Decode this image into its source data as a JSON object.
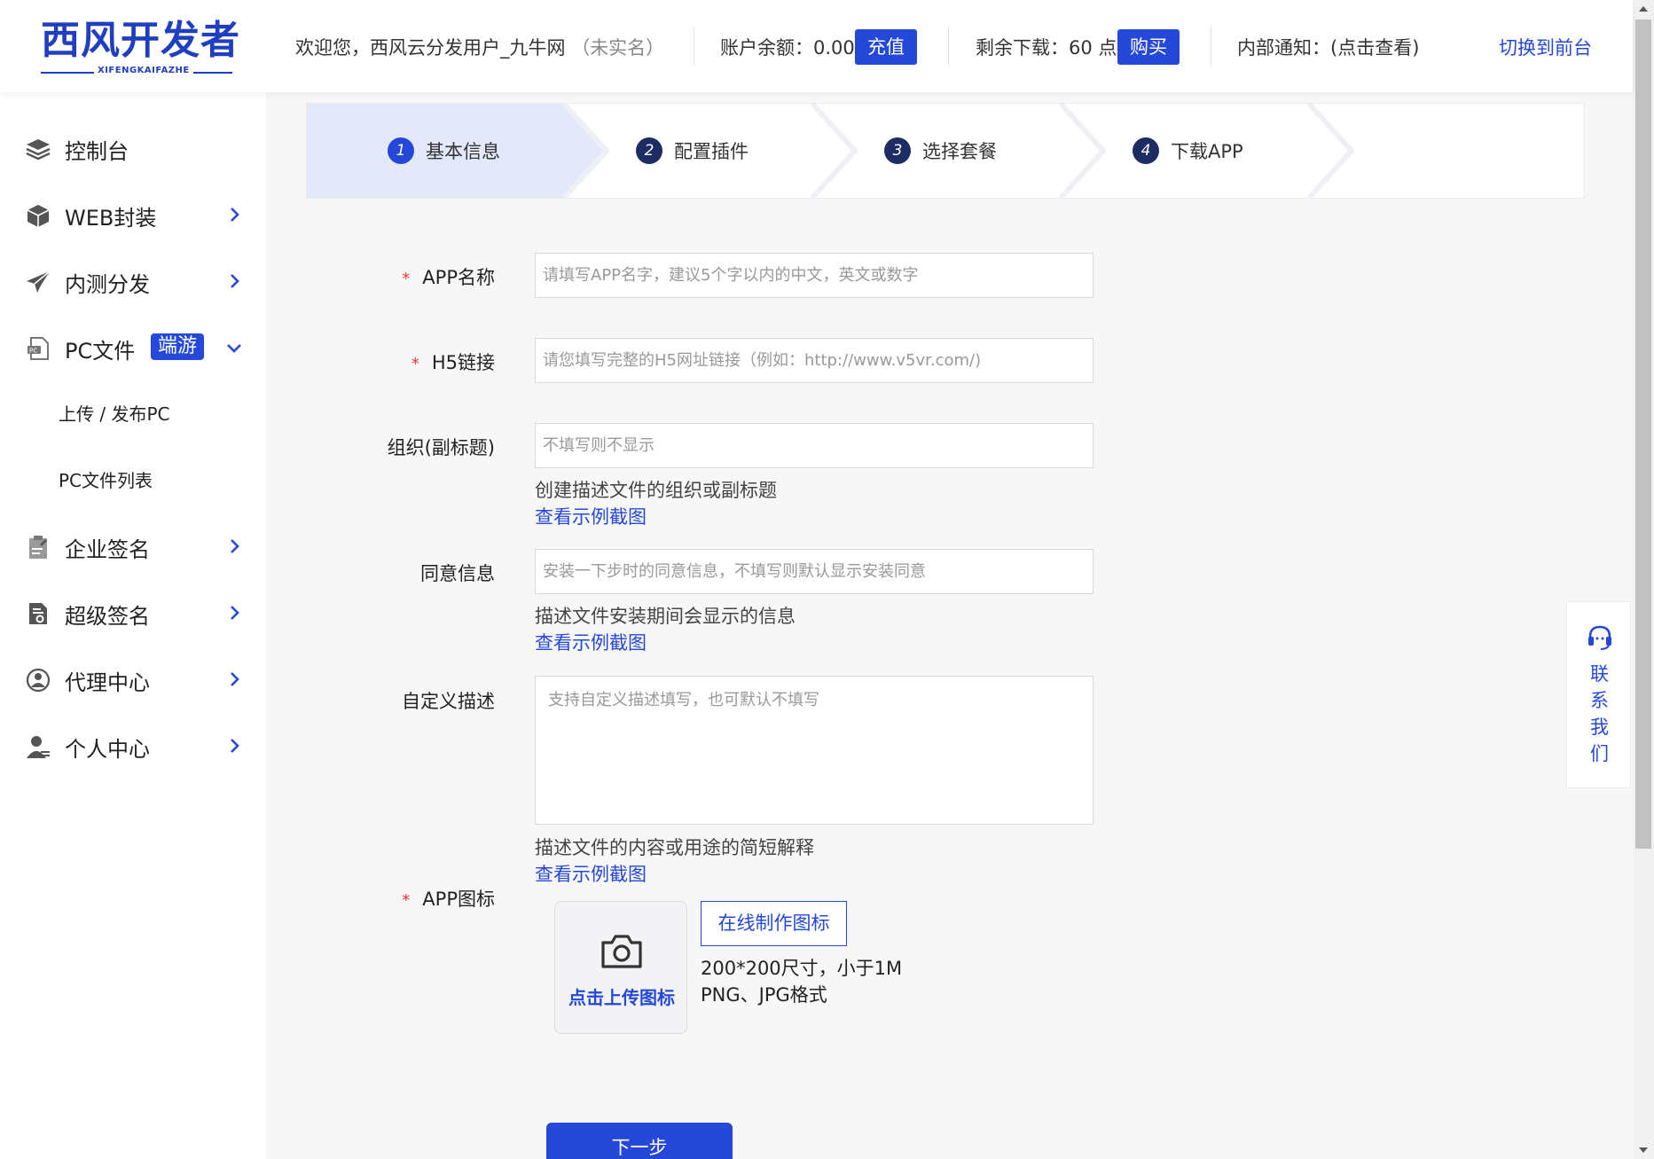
{
  "header": {
    "logo_main": "西风开发者",
    "logo_sub": "XIFENGKAIFAZHE",
    "welcome_prefix": "欢迎您，西风云分发用户_九牛网",
    "welcome_status": "（未实名）",
    "balance_label": "账户余额：0.00",
    "recharge_button": "充值",
    "downloads_label": "剩余下载：60 点",
    "buy_button": "购买",
    "notice_label": "内部通知：(点击查看)",
    "switch_link": "切换到前台"
  },
  "sidebar": {
    "items": [
      {
        "label": "控制台",
        "icon": "layers-icon"
      },
      {
        "label": "WEB封装",
        "icon": "package-icon"
      },
      {
        "label": "内测分发",
        "icon": "paper-plane-icon"
      },
      {
        "label": "PC文件",
        "icon": "pc-file-icon",
        "badge": "端游"
      },
      {
        "label": "企业签名",
        "icon": "clipboard-icon"
      },
      {
        "label": "超级签名",
        "icon": "certificate-icon"
      },
      {
        "label": "代理中心",
        "icon": "agent-icon"
      },
      {
        "label": "个人中心",
        "icon": "user-icon"
      }
    ],
    "subitems": [
      {
        "label": "上传 / 发布PC"
      },
      {
        "label": "PC文件列表"
      }
    ]
  },
  "steps": [
    {
      "num": "1",
      "label": "基本信息"
    },
    {
      "num": "2",
      "label": "配置插件"
    },
    {
      "num": "3",
      "label": "选择套餐"
    },
    {
      "num": "4",
      "label": "下载APP"
    }
  ],
  "form": {
    "app_name": {
      "label": "APP名称",
      "required_mark": "*",
      "placeholder": "请填写APP名字，建议5个字以内的中文，英文或数字"
    },
    "h5_link": {
      "label": "H5链接",
      "required_mark": "*",
      "placeholder": "请您填写完整的H5网址链接（例如：http://www.v5vr.com/)"
    },
    "org": {
      "label": "组织(副标题)",
      "placeholder": "不填写则不显示",
      "help": "创建描述文件的组织或副标题",
      "example_link": "查看示例截图"
    },
    "consent": {
      "label": "同意信息",
      "placeholder": "安装一下步时的同意信息，不填写则默认显示安装同意",
      "help": "描述文件安装期间会显示的信息",
      "example_link": "查看示例截图"
    },
    "description": {
      "label": "自定义描述",
      "placeholder": "支持自定义描述填写，也可默认不填写",
      "help": "描述文件的内容或用途的简短解释",
      "example_link": "查看示例截图"
    },
    "app_icon": {
      "label": "APP图标",
      "required_mark": "*",
      "upload_text": "点击上传图标",
      "online_button": "在线制作图标",
      "size_note": "200*200尺寸，小于1M",
      "format_note": "PNG、JPG格式"
    },
    "next_button": "下一步"
  },
  "contact": {
    "text": "联系我们",
    "icon": "headset-icon"
  },
  "colors": {
    "accent": "#2548d9",
    "step_dark": "#1d2d64",
    "required": "#e33333"
  }
}
